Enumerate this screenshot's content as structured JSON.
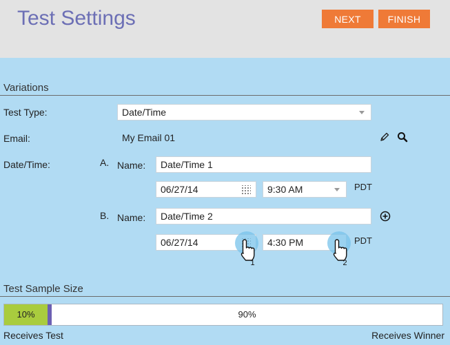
{
  "header": {
    "title": "Test Settings",
    "next_label": "NEXT",
    "finish_label": "FINISH",
    "button_color": "#ef7a37"
  },
  "variations": {
    "section_title": "Variations",
    "test_type_label": "Test Type:",
    "test_type_value": "Date/Time",
    "email_label": "Email:",
    "email_value": "My Email 01",
    "email_icons": [
      "pencil-icon",
      "search-icon"
    ],
    "datetime_label": "Date/Time:",
    "name_label": "Name:",
    "tz": "PDT",
    "items": [
      {
        "marker": "A.",
        "name": "Date/Time 1",
        "date": "06/27/14",
        "time": "9:30 AM"
      },
      {
        "marker": "B.",
        "name": "Date/Time 2",
        "date": "06/27/14",
        "time": "4:30 PM"
      }
    ],
    "add_icon": "plus-circle-icon"
  },
  "callouts": [
    "1",
    "2"
  ],
  "sample": {
    "section_title": "Test Sample Size",
    "test_percent": "10%",
    "winner_percent": "90%",
    "test_fraction": 0.1,
    "receives_test_label": "Receives Test",
    "receives_winner_label": "Receives Winner",
    "test_color": "#a9cc3e",
    "handle_color": "#6c5fb2"
  }
}
